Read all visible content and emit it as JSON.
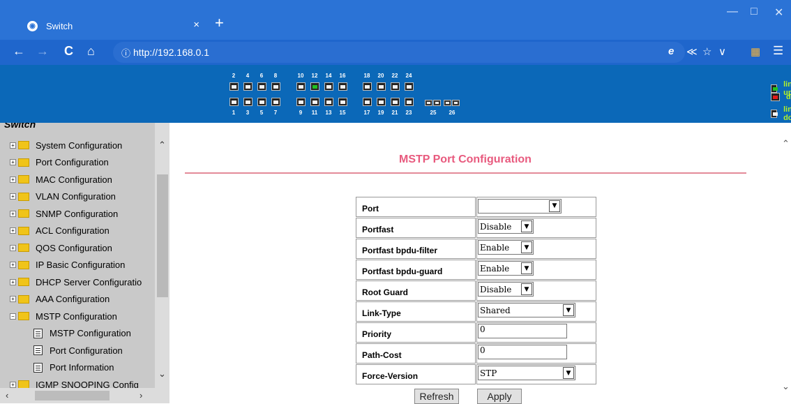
{
  "browser": {
    "tab_title": "Switch",
    "tab_close": "×",
    "new_tab": "+",
    "url_prefix": "ⓘ",
    "url": "http://192.168.0.1",
    "controls": {
      "minimize": "—",
      "maximize": "□",
      "close": "✕"
    },
    "nav": {
      "back": "←",
      "forward": "→",
      "reload": "C",
      "home": "⌂"
    },
    "addr_icons": [
      "e",
      "≪",
      "☆",
      "∨",
      "▦",
      "☰"
    ]
  },
  "banner": {
    "top_numbers": [
      "2",
      "4",
      "6",
      "8",
      "10",
      "12",
      "14",
      "16",
      "18",
      "20",
      "22",
      "24"
    ],
    "bottom_numbers": [
      "1",
      "3",
      "5",
      "7",
      "9",
      "11",
      "13",
      "15",
      "17",
      "19",
      "21",
      "23"
    ],
    "sfp_numbers": [
      "25",
      "26"
    ],
    "link_up_port": "12",
    "legend": {
      "up": "link up",
      "disable": "disable",
      "down": "link down"
    },
    "colors": {
      "background": "#0b68b8",
      "link_up": "#21c21e",
      "disable": "#e31a1a",
      "legend_text": "#b2f02a"
    }
  },
  "sidebar": {
    "root": "Switch",
    "items": [
      {
        "label": "System Configuration",
        "type": "folder",
        "expander": "+"
      },
      {
        "label": "Port Configuration",
        "type": "folder",
        "expander": "+"
      },
      {
        "label": "MAC Configuration",
        "type": "folder",
        "expander": "+"
      },
      {
        "label": "VLAN Configuration",
        "type": "folder",
        "expander": "+"
      },
      {
        "label": "SNMP Configuration",
        "type": "folder",
        "expander": "+"
      },
      {
        "label": "ACL Configuration",
        "type": "folder",
        "expander": "+"
      },
      {
        "label": "QOS Configuration",
        "type": "folder",
        "expander": "+"
      },
      {
        "label": "IP Basic Configuration",
        "type": "folder",
        "expander": "+"
      },
      {
        "label": "DHCP Server Configuratio",
        "type": "folder",
        "expander": "+"
      },
      {
        "label": "AAA Configuration",
        "type": "folder",
        "expander": "+"
      },
      {
        "label": "MSTP Configuration",
        "type": "folder-open",
        "expander": "−"
      },
      {
        "label": "MSTP Configuration",
        "type": "page"
      },
      {
        "label": "Port Configuration",
        "type": "page"
      },
      {
        "label": "Port Information",
        "type": "page"
      },
      {
        "label": "IGMP SNOOPING Config",
        "type": "folder",
        "expander": "+"
      }
    ]
  },
  "main": {
    "title": "MSTP Port Configuration",
    "fields": [
      {
        "label": "Port",
        "control": "select",
        "value": "",
        "size": "wide"
      },
      {
        "label": "Portfast",
        "control": "select",
        "value": "Disable",
        "size": "small"
      },
      {
        "label": "Portfast bpdu-filter",
        "control": "select",
        "value": "Enable",
        "size": "small"
      },
      {
        "label": "Portfast bpdu-guard",
        "control": "select",
        "value": "Enable",
        "size": "small"
      },
      {
        "label": "Root Guard",
        "control": "select",
        "value": "Disable",
        "size": "small"
      },
      {
        "label": "Link-Type",
        "control": "select",
        "value": "Shared",
        "size": "large"
      },
      {
        "label": "Priority",
        "control": "input",
        "value": "0"
      },
      {
        "label": "Path-Cost",
        "control": "input",
        "value": "0"
      },
      {
        "label": "Force-Version",
        "control": "select",
        "value": "STP",
        "size": "large"
      }
    ],
    "buttons": {
      "refresh": "Refresh",
      "apply": "Apply"
    }
  }
}
